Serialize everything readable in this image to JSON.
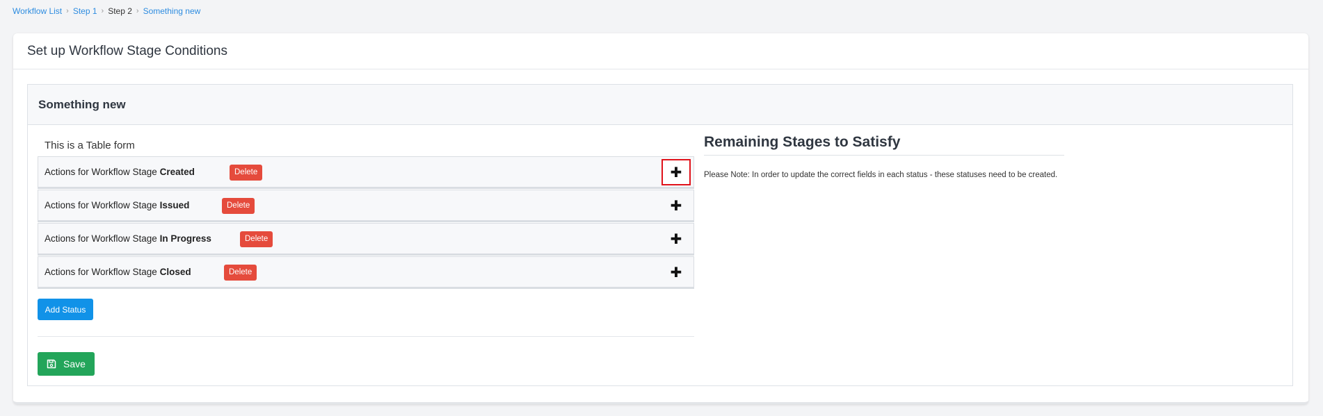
{
  "breadcrumb": {
    "items": [
      "Workflow List",
      "Step 1",
      "Step 2",
      "Something new"
    ],
    "separator": "›"
  },
  "card": {
    "title": "Set up Workflow Stage Conditions"
  },
  "panel": {
    "title": "Something new",
    "form_label": "This is a Table form"
  },
  "stages": [
    {
      "prefix": "Actions for Workflow Stage ",
      "name": "Created",
      "delete_label": "Delete",
      "expand_icon": "plus-icon"
    },
    {
      "prefix": "Actions for Workflow Stage ",
      "name": "Issued",
      "delete_label": "Delete",
      "expand_icon": "plus-icon"
    },
    {
      "prefix": "Actions for Workflow Stage ",
      "name": "In Progress",
      "delete_label": "Delete",
      "expand_icon": "plus-icon"
    },
    {
      "prefix": "Actions for Workflow Stage ",
      "name": "Closed",
      "delete_label": "Delete",
      "expand_icon": "plus-icon"
    }
  ],
  "actions": {
    "add_status_label": "Add Status",
    "save_label": "Save",
    "save_icon": "floppy-disk-icon"
  },
  "remaining": {
    "title": "Remaining Stages to Satisfy",
    "note": "Please Note: In order to update the correct fields in each status - these statuses need to be created."
  },
  "colors": {
    "link": "#2d8ce0",
    "delete": "#e54b3c",
    "add_status": "#1192e8",
    "save": "#23a55a",
    "highlight_border": "#e0121a"
  }
}
